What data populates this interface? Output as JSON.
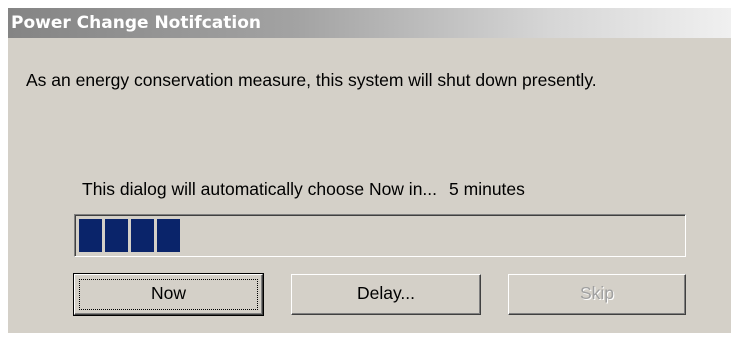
{
  "window": {
    "title": "Power Change Notifcation"
  },
  "message": "As an energy conservation measure, this system will shut down presently.",
  "countdown": {
    "prefix": "This dialog will automatically choose Now in...",
    "time_remaining": "5 minutes"
  },
  "progress": {
    "filled_blocks": 4,
    "fraction": 0.18,
    "color": "#0a246a"
  },
  "buttons": {
    "now": {
      "label": "Now",
      "default": true
    },
    "delay": {
      "label": "Delay..."
    },
    "skip": {
      "label": "Skip",
      "disabled": true
    }
  },
  "colors": {
    "dialog_background": "#d4d0c8",
    "title_text": "#ffffff"
  }
}
